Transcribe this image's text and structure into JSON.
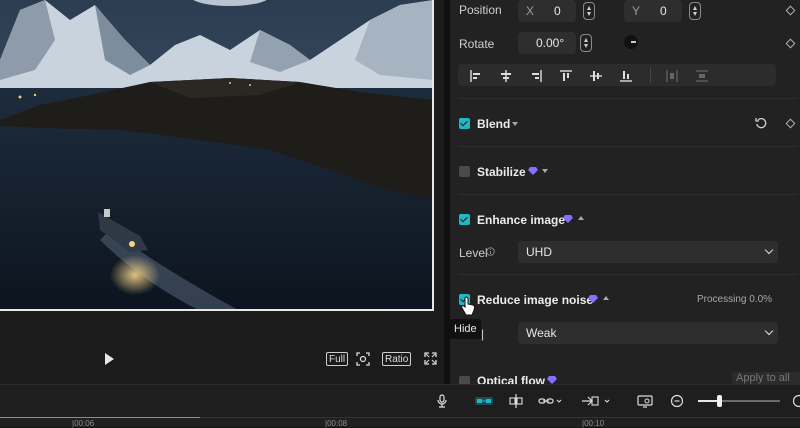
{
  "properties": {
    "position_label": "Position",
    "x_label": "X",
    "x_value": "0",
    "y_label": "Y",
    "y_value": "0",
    "rotate_label": "Rotate",
    "rotate_value": "0.00°"
  },
  "sections": {
    "blend": {
      "label": "Blend",
      "checked": true
    },
    "stabilize": {
      "label": "Stabilize",
      "checked": false
    },
    "enhance": {
      "label": "Enhance image",
      "checked": true,
      "level_label": "Level",
      "level_value": "UHD"
    },
    "noise": {
      "label": "Reduce image noise",
      "checked": true,
      "status": "Processing 0.0%",
      "value": "Weak"
    },
    "optical": {
      "label": "Optical flow",
      "apply_label": "Apply to all"
    }
  },
  "tooltip": "Hide",
  "player": {
    "full_label": "Full",
    "ratio_label": "Ratio"
  },
  "timeline": {
    "ticks": [
      "|00:06",
      "|00:08",
      "|00:10"
    ],
    "zoom_level": 0.25
  },
  "colors": {
    "accent": "#22b7c4",
    "pro_badge": "#8b6cff",
    "panel_bg": "#222222"
  },
  "icons": [
    "play-icon",
    "screenshot-icon",
    "fullscreen-icon",
    "reset-icon",
    "keyframe-icon",
    "mic-icon",
    "magnet-icon",
    "split-icon",
    "link-icon",
    "preview-icon",
    "zoom-out-icon"
  ]
}
